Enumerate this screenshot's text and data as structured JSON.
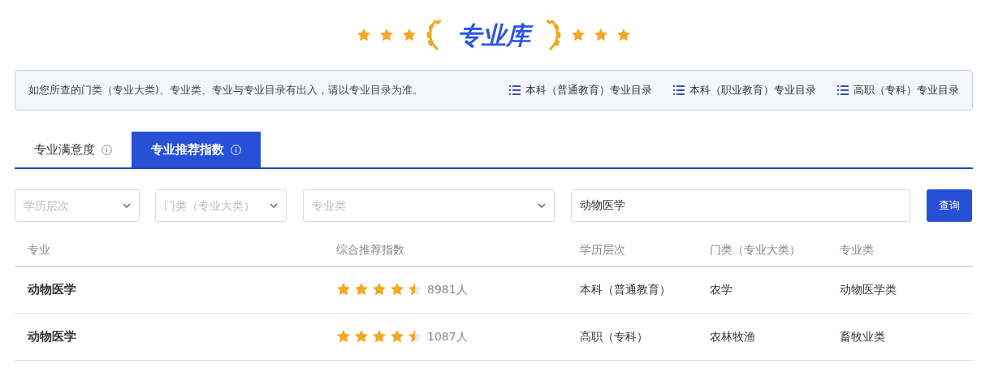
{
  "header": {
    "title": "专业库"
  },
  "notice": {
    "text": "如您所查的门类（专业大类)、专业类、专业与专业目录有出入，请以专业目录为准。",
    "links": [
      "本科（普通教育）专业目录",
      "本科（职业教育）专业目录",
      "高职（专科）专业目录"
    ]
  },
  "tabs": [
    {
      "label": "专业满意度",
      "selected": false
    },
    {
      "label": "专业推荐指数",
      "selected": true
    }
  ],
  "filters": {
    "selects": [
      {
        "placeholder": "学历层次"
      },
      {
        "placeholder": "门类（专业大类）"
      },
      {
        "placeholder": "专业类"
      }
    ],
    "search": {
      "value": "动物医学"
    },
    "button": "查询"
  },
  "table": {
    "columns": [
      "专业",
      "综合推荐指数",
      "学历层次",
      "门类（专业大类）",
      "专业类"
    ],
    "rows": [
      {
        "name": "动物医学",
        "stars": 4.5,
        "count": "8981人",
        "level": "本科（普通教育）",
        "category": "农学",
        "subcategory": "动物医学类"
      },
      {
        "name": "动物医学",
        "stars": 4.5,
        "count": "1087人",
        "level": "高职（专科）",
        "category": "农林牧渔",
        "subcategory": "畜牧业类"
      }
    ]
  }
}
